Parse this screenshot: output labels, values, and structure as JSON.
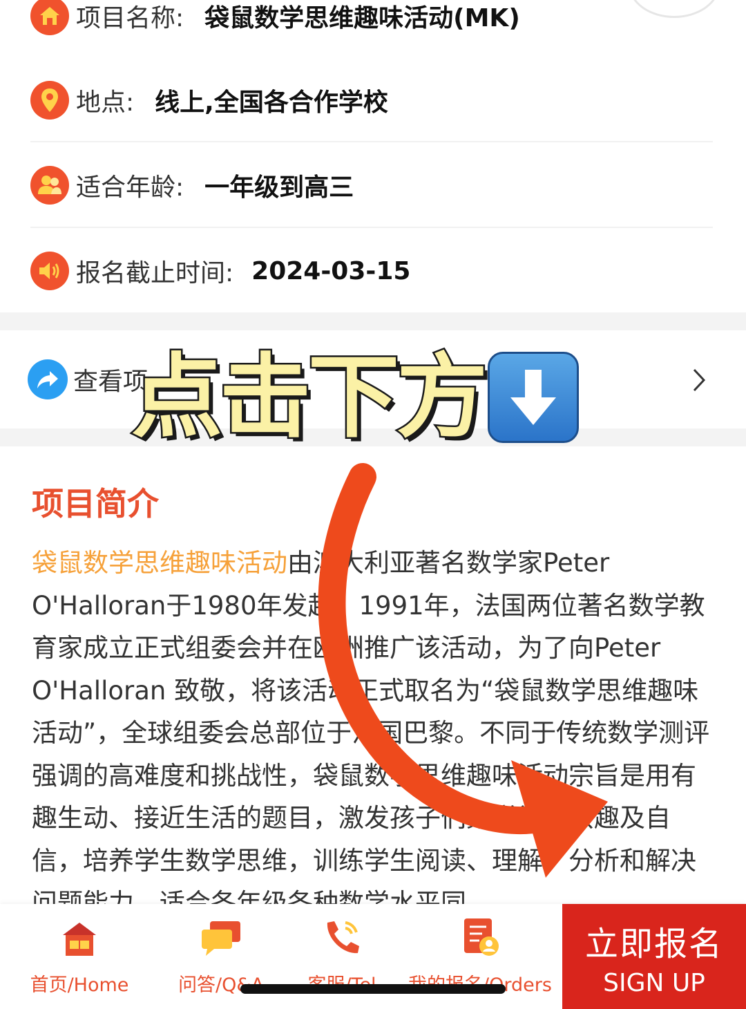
{
  "info": {
    "name_label": "项目名称:",
    "name_value": "袋鼠数学思维趣味活动(MK)",
    "location_label": "地点:",
    "location_value": "线上,全国各合作学校",
    "age_label": "适合年龄:",
    "age_value": "一年级到高三",
    "deadline_label": "报名截止时间:",
    "deadline_value": "2024-03-15"
  },
  "link_row": {
    "label": "查看项"
  },
  "overlay": {
    "text": "点击下方"
  },
  "section": {
    "title": "项目简介"
  },
  "intro": {
    "highlight": "袋鼠数学思维趣味活动",
    "body": "由澳大利亚著名数学家Peter O'Halloran于1980年发起。1991年，法国两位著名数学教育家成立正式组委会并在欧洲推广该活动，为了向Peter O'Halloran 致敬，将该活动正式取名为“袋鼠数学思维趣味活动”，全球组委会总部位于法国巴黎。不同于传统数学测评强调的高难度和挑战性，袋鼠数学思维趣味活动宗旨是用有趣生动、接近生活的题目，激发孩子们数学学习兴趣及自信，培养学生数学思维，训练学生阅读、理解、分析和解决问题能力，适合各年级各种数学水平同"
  },
  "tabs": [
    {
      "label": "首页/Home",
      "icon": "home-icon"
    },
    {
      "label": "问答/Q&A",
      "icon": "chat-icon"
    },
    {
      "label": "客服/Tel",
      "icon": "phone-icon"
    },
    {
      "label": "我的报名/Orders",
      "icon": "orders-icon"
    }
  ],
  "signup": {
    "cn": "立即报名",
    "en": "SIGN UP"
  },
  "colors": {
    "accent": "#e8502f",
    "signup_bg": "#d9251c",
    "highlight": "#f6a13a",
    "link_icon": "#2b9ff2"
  }
}
